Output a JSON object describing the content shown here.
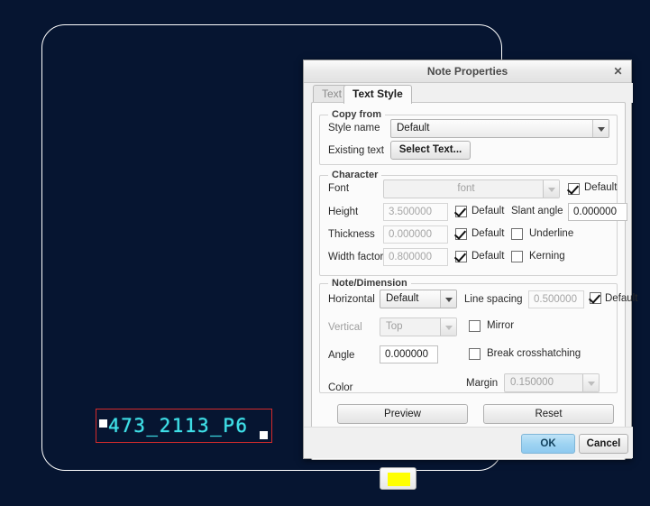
{
  "canvas": {
    "name": "cad-drawing-canvas",
    "background_color": "#061531",
    "sheet_outline_color": "#ffffff",
    "selection_box_color": "#d42b2b",
    "text_color": "#3fe0e8",
    "selected_text": "473_2113_P6"
  },
  "dialog": {
    "title": "Note Properties",
    "close_label": "✕",
    "tabs": [
      {
        "label": "Text",
        "active": false
      },
      {
        "label": "Text Style",
        "active": true
      }
    ],
    "groups": {
      "copy_from": {
        "legend": "Copy from",
        "style_name_label": "Style name",
        "style_name_value": "Default",
        "existing_text_label": "Existing text",
        "select_text_button": "Select Text..."
      },
      "character": {
        "legend": "Character",
        "font_label": "Font",
        "font_value": "font",
        "font_default_label": "Default",
        "font_default_checked": true,
        "height_label": "Height",
        "height_value": "3.500000",
        "height_default_label": "Default",
        "height_default_checked": true,
        "slant_angle_label": "Slant angle",
        "slant_angle_value": "0.000000",
        "thickness_label": "Thickness",
        "thickness_value": "0.000000",
        "thickness_default_label": "Default",
        "thickness_default_checked": true,
        "underline_label": "Underline",
        "underline_checked": false,
        "width_factor_label": "Width factor",
        "width_factor_value": "0.800000",
        "width_factor_default_label": "Default",
        "width_factor_default_checked": true,
        "kerning_label": "Kerning",
        "kerning_checked": false
      },
      "note_dimension": {
        "legend": "Note/Dimension",
        "horizontal_label": "Horizontal",
        "horizontal_value": "Default",
        "line_spacing_label": "Line spacing",
        "line_spacing_value": "0.500000",
        "line_spacing_default_label": "Default",
        "line_spacing_default_checked": true,
        "vertical_label": "Vertical",
        "vertical_value": "Top",
        "mirror_label": "Mirror",
        "mirror_checked": false,
        "angle_label": "Angle",
        "angle_value": "0.000000",
        "break_crosshatching_label": "Break crosshatching",
        "break_crosshatching_checked": false,
        "color_label": "Color",
        "color_value": "#ffff00",
        "margin_label": "Margin",
        "margin_value": "0.150000"
      }
    },
    "actions": {
      "preview": "Preview",
      "reset": "Reset",
      "ok": "OK",
      "cancel": "Cancel"
    }
  }
}
